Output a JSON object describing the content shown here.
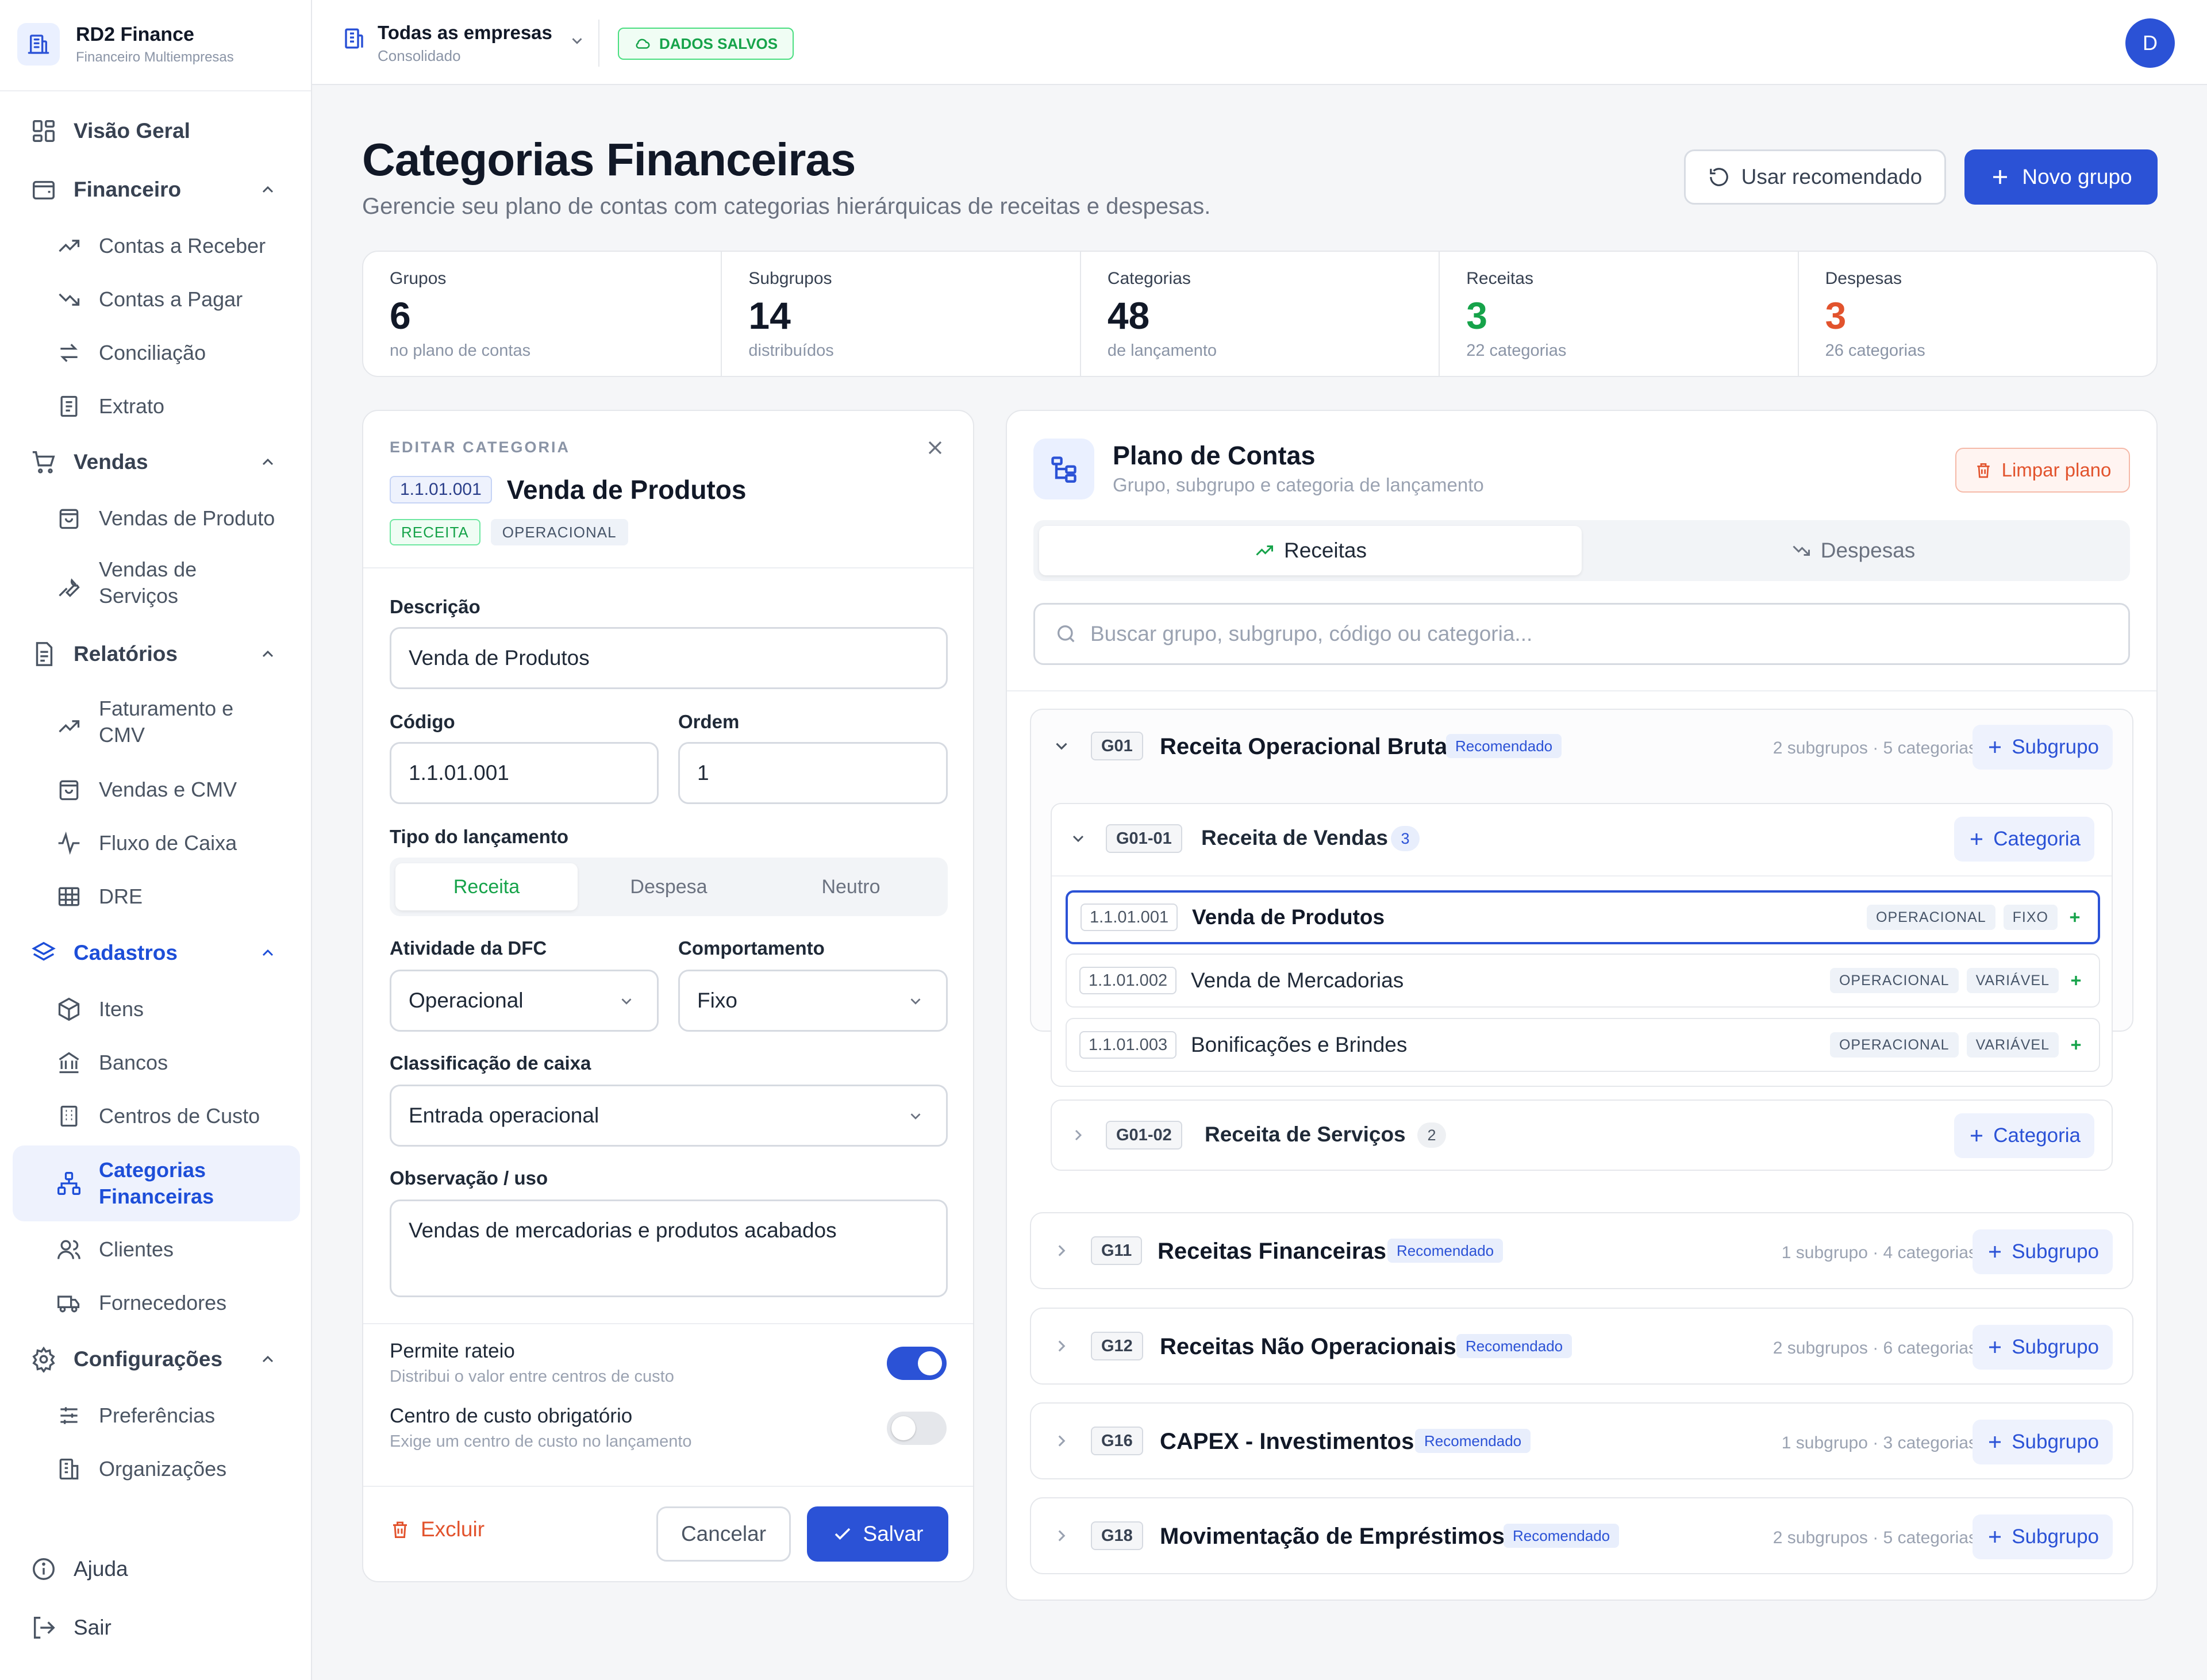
{
  "brand": {
    "name": "RD2 Finance",
    "subtitle": "Financeiro Multiempresas"
  },
  "sidebar": {
    "items": [
      {
        "label": "Visão Geral",
        "icon": "dashboard-icon"
      },
      {
        "label": "Financeiro",
        "icon": "wallet-icon",
        "expanded": true
      },
      {
        "label": "Contas a Receber",
        "icon": "trending-up-icon"
      },
      {
        "label": "Contas a Pagar",
        "icon": "trending-down-icon"
      },
      {
        "label": "Conciliação",
        "icon": "arrows-exchange-icon"
      },
      {
        "label": "Extrato",
        "icon": "receipt-icon"
      },
      {
        "label": "Vendas",
        "icon": "cart-icon",
        "expanded": true
      },
      {
        "label": "Vendas de Produto",
        "icon": "shopping-bag-icon"
      },
      {
        "label": "Vendas de Serviços",
        "icon": "wrench-icon"
      },
      {
        "label": "Relatórios",
        "icon": "report-icon",
        "expanded": true
      },
      {
        "label": "Faturamento e CMV",
        "icon": "trending-up-icon"
      },
      {
        "label": "Vendas e CMV",
        "icon": "shopping-bag-icon"
      },
      {
        "label": "Fluxo de Caixa",
        "icon": "activity-icon"
      },
      {
        "label": "DRE",
        "icon": "table-icon"
      },
      {
        "label": "Cadastros",
        "icon": "layers-icon",
        "expanded": true
      },
      {
        "label": "Itens",
        "icon": "package-icon"
      },
      {
        "label": "Bancos",
        "icon": "bank-icon"
      },
      {
        "label": "Centros de Custo",
        "icon": "building-icon"
      },
      {
        "label": "Categorias Financeiras",
        "icon": "hierarchy-icon",
        "active": true
      },
      {
        "label": "Clientes",
        "icon": "users-icon"
      },
      {
        "label": "Fornecedores",
        "icon": "truck-icon"
      },
      {
        "label": "Configurações",
        "icon": "gear-icon",
        "expanded": true
      },
      {
        "label": "Preferências",
        "icon": "sliders-icon"
      },
      {
        "label": "Organizações",
        "icon": "buildings-icon"
      }
    ],
    "help": "Ajuda",
    "logout": "Sair"
  },
  "topbar": {
    "company": "Todas as empresas",
    "company_sub": "Consolidado",
    "saved_status": "DADOS SALVOS",
    "avatar_initial": "D"
  },
  "header": {
    "title": "Categorias Financeiras",
    "subtitle": "Gerencie seu plano de contas com categorias hierárquicas de receitas e despesas.",
    "btn_recommended": "Usar recomendado",
    "btn_new_group": "Novo grupo"
  },
  "stats": [
    {
      "label": "Grupos",
      "value": "6",
      "note": "no plano de contas"
    },
    {
      "label": "Subgrupos",
      "value": "14",
      "note": "distribuídos"
    },
    {
      "label": "Categorias",
      "value": "48",
      "note": "de lançamento"
    },
    {
      "label": "Receitas",
      "value": "3",
      "note": "22 categorias"
    },
    {
      "label": "Despesas",
      "value": "3",
      "note": "26 categorias"
    }
  ],
  "edit": {
    "kicker": "EDITAR CATEGORIA",
    "code": "1.1.01.001",
    "name": "Venda de Produtos",
    "badge_type": "RECEITA",
    "badge_activity": "OPERACIONAL",
    "desc_label": "Descrição",
    "desc_value": "Venda de Produtos",
    "code_label": "Código",
    "code_value": "1.1.01.001",
    "order_label": "Ordem",
    "order_value": "1",
    "type_label": "Tipo do lançamento",
    "type_options": [
      "Receita",
      "Despesa",
      "Neutro"
    ],
    "dfc_label": "Atividade da DFC",
    "dfc_value": "Operacional",
    "behavior_label": "Comportamento",
    "behavior_value": "Fixo",
    "class_label": "Classificação de caixa",
    "class_value": "Entrada operacional",
    "obs_label": "Observação / uso",
    "obs_value": "Vendas de mercadorias e produtos acabados",
    "rateio_title": "Permite rateio",
    "rateio_sub": "Distribui o valor entre centros de custo",
    "rateio_on": true,
    "cc_title": "Centro de custo obrigatório",
    "cc_sub": "Exige um centro de custo no lançamento",
    "cc_on": false,
    "btn_delete": "Excluir",
    "btn_cancel": "Cancelar",
    "btn_save": "Salvar"
  },
  "plan": {
    "title": "Plano de Contas",
    "subtitle": "Grupo, subgrupo e categoria de lançamento",
    "btn_clear": "Limpar plano",
    "tab_income": "Receitas",
    "tab_expense": "Despesas",
    "search_placeholder": "Buscar grupo, subgrupo, código ou categoria...",
    "recommended": "Recomendado",
    "btn_subgroup": "Subgrupo",
    "btn_category": "Categoria",
    "groups": [
      {
        "code": "G01",
        "name": "Receita Operacional Bruta",
        "count": "2 subgrupos · 5 categorias",
        "expanded": true
      },
      {
        "code": "G11",
        "name": "Receitas Financeiras",
        "count": "1 subgrupo · 4 categorias"
      },
      {
        "code": "G12",
        "name": "Receitas Não Operacionais",
        "count": "2 subgrupos · 6 categorias"
      },
      {
        "code": "G16",
        "name": "CAPEX - Investimentos",
        "count": "1 subgrupo · 3 categorias"
      },
      {
        "code": "G18",
        "name": "Movimentação de Empréstimos",
        "count": "2 subgrupos · 5 categorias"
      }
    ],
    "subgroups": [
      {
        "code": "G01-01",
        "name": "Receita de Vendas",
        "count": "3"
      },
      {
        "code": "G01-02",
        "name": "Receita de Serviços",
        "count": "2"
      }
    ],
    "categories": [
      {
        "code": "1.1.01.001",
        "name": "Venda de Produtos",
        "tags": [
          "OPERACIONAL",
          "FIXO"
        ]
      },
      {
        "code": "1.1.01.002",
        "name": "Venda de Mercadorias",
        "tags": [
          "OPERACIONAL",
          "VARIÁVEL"
        ]
      },
      {
        "code": "1.1.01.003",
        "name": "Bonificações e Brindes",
        "tags": [
          "OPERACIONAL",
          "VARIÁVEL"
        ]
      }
    ]
  },
  "colors": {
    "primary": "#2b52d6",
    "income": "#16a34a",
    "expense": "#e2532d"
  }
}
